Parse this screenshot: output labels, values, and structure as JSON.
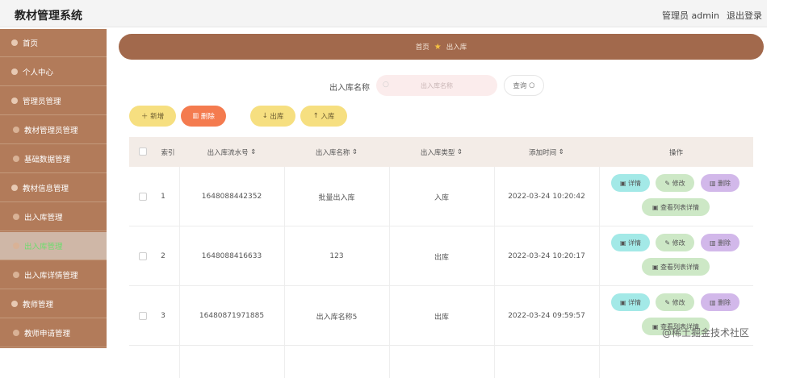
{
  "app": {
    "title": "教材管理系统"
  },
  "topbar": {
    "user": "管理员 admin",
    "logout": "退出登录"
  },
  "sidebar": {
    "items": [
      {
        "label": "首页"
      },
      {
        "label": "个人中心"
      },
      {
        "label": "管理员管理"
      },
      {
        "label": "教材管理员管理"
      },
      {
        "label": "基础数据管理"
      },
      {
        "label": "教材信息管理"
      },
      {
        "label": "出入库管理"
      },
      {
        "label": "出入库管理"
      },
      {
        "label": "出入库详情管理"
      },
      {
        "label": "教师管理"
      },
      {
        "label": "教师申请管理"
      }
    ]
  },
  "breadcrumb": {
    "home": "首页",
    "current": "出入库"
  },
  "search": {
    "label": "出入库名称",
    "placeholder": "出入库名称",
    "button": "查询"
  },
  "actions": {
    "add": "新增",
    "delete": "删除",
    "out": "出库",
    "in": "入库"
  },
  "table": {
    "headers": {
      "index": "索引",
      "serial": "出入库流水号",
      "name": "出入库名称",
      "type": "出入库类型",
      "time": "添加时间",
      "ops": "操作"
    },
    "rows": [
      {
        "index": "1",
        "serial": "1648088442352",
        "name": "批量出入库",
        "type": "入库",
        "time": "2022-03-24 10:20:42"
      },
      {
        "index": "2",
        "serial": "1648088416633",
        "name": "123",
        "type": "出库",
        "time": "2022-03-24 10:20:17"
      },
      {
        "index": "3",
        "serial": "16480871971885",
        "name": "出入库名称5",
        "type": "出库",
        "time": "2022-03-24 09:59:57"
      }
    ],
    "ops": {
      "detail": "详情",
      "edit": "修改",
      "delete": "删除",
      "list": "查看列表详情"
    }
  },
  "watermark": "@稀土掘金技术社区",
  "colors": {
    "sidebar": "#b27b5a",
    "breadcrumb": "#a2694c",
    "add": "#f6df80",
    "delete": "#f47b4f",
    "detail": "#a3e9e7",
    "edit": "#cde8c6",
    "opdelete": "#d2b8ea"
  }
}
